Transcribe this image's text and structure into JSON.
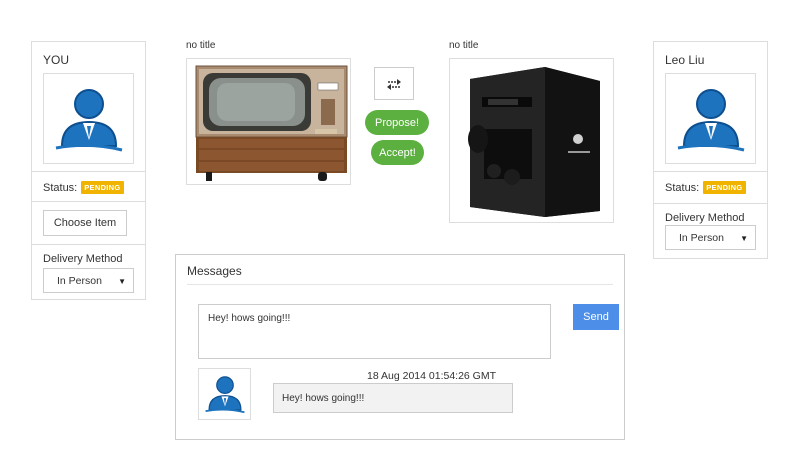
{
  "you_panel": {
    "name": "YOU",
    "status_label": "Status:",
    "status_badge": "PENDING",
    "choose_item_label": "Choose Item",
    "delivery_label": "Delivery Method",
    "delivery_value": "In Person"
  },
  "other_panel": {
    "name": "Leo Liu",
    "status_label": "Status:",
    "status_badge": "PENDING",
    "delivery_label": "Delivery Method",
    "delivery_value": "In Person"
  },
  "trade": {
    "left_item_title": "no title",
    "right_item_title": "no title",
    "propose_label": "Propose!",
    "accept_label": "Accept!"
  },
  "messages": {
    "heading": "Messages",
    "input_value": "Hey! hows going!!!",
    "send_label": "Send",
    "items": [
      {
        "timestamp": "18 Aug 2014 01:54:26 GMT",
        "text": "Hey! hows going!!!"
      }
    ]
  },
  "colors": {
    "badge": "#f0b400",
    "action_green": "#5cb040",
    "send_blue": "#4d8ee8",
    "avatar_blue": "#1e73be"
  }
}
